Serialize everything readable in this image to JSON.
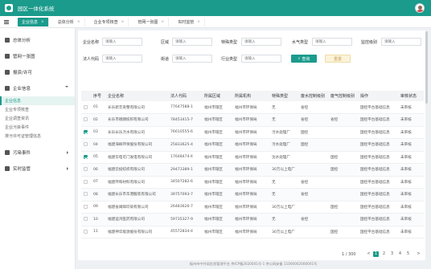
{
  "app": {
    "title": "园区一体化系统"
  },
  "tabs": [
    {
      "label": "企业信息",
      "close": "×"
    },
    {
      "label": "总体分析",
      "close": "×"
    },
    {
      "label": "企业专项核查",
      "close": "×"
    },
    {
      "label": "管网一张图",
      "close": "×"
    },
    {
      "label": "实时监管",
      "close": "×"
    }
  ],
  "sidebar": {
    "groups": [
      {
        "label": "总体分析"
      },
      {
        "label": "管网一张图"
      },
      {
        "label": "报资/许可"
      },
      {
        "label": "企业信息"
      },
      {
        "label": "污染事件"
      },
      {
        "label": "实时监管"
      }
    ],
    "sub_items": [
      {
        "label": "企业信息"
      },
      {
        "label": "企业专项核查"
      },
      {
        "label": "企业调查资讯"
      },
      {
        "label": "企业污染事件"
      },
      {
        "label": "排污许可证管理信息"
      }
    ]
  },
  "filters": {
    "company_name": {
      "label": "企业名称",
      "placeholder": "请输入"
    },
    "district": {
      "label": "区域",
      "placeholder": "请输入"
    },
    "special_type": {
      "label": "特殊类型",
      "placeholder": "请输入"
    },
    "water_type": {
      "label": "水气类型",
      "placeholder": "请输入"
    },
    "control_level": {
      "label": "监控级别",
      "placeholder": "请输入"
    },
    "legal_person": {
      "label": "法人代码",
      "placeholder": "请输入"
    },
    "street": {
      "label": "街道",
      "placeholder": "请输入"
    },
    "industry_type": {
      "label": "行业类型",
      "placeholder": "请输入"
    },
    "query_label": "查询",
    "reset_label": "重置"
  },
  "table": {
    "columns": [
      "序号",
      "企业名称",
      "法人代码",
      "所属区域",
      "所属机构",
      "特殊类型",
      "废水控制级别",
      "废气控制级别",
      "操作",
      "审核状态"
    ],
    "rows": [
      {
        "checked": false,
        "no": "01",
        "name": "长乐新丰染整有限公司",
        "code": "77647588-1",
        "area": "福州市辖区",
        "org": "福州市环保局",
        "special": "无",
        "water": "省控",
        "gas": "",
        "op": "国控平台基础信息",
        "status": "未审核"
      },
      {
        "checked": false,
        "no": "02",
        "name": "长乐市德朗纺织有限公司",
        "code": "78453415-7",
        "area": "福州市辖区",
        "org": "福州市环保局",
        "special": "无",
        "water": "省控",
        "gas": "省控",
        "op": "国控平台基础信息",
        "status": "未审核"
      },
      {
        "checked": true,
        "no": "03",
        "name": "长乐长乐污水有限公司",
        "code": "76610555-6",
        "area": "福州市辖区",
        "org": "福州市环保局",
        "special": "污水处理厂",
        "water": "国控",
        "gas": "",
        "op": "国控平台基础信息",
        "status": "未审核"
      },
      {
        "checked": false,
        "no": "04",
        "name": "福建海峡环保股份有限公司",
        "code": "25833625-4",
        "area": "福州市辖区",
        "org": "福州市环保局",
        "special": "污水处理厂",
        "water": "国控",
        "gas": "",
        "op": "国控平台基础信息",
        "status": "未审核"
      },
      {
        "checked": true,
        "no": "05",
        "name": "福建华电可门发电有限公司",
        "code": "17648474-X",
        "area": "福州市辖区",
        "org": "福州市环保局",
        "special": "沈水处理厂",
        "water": "",
        "gas": "国控",
        "op": "国控平台基础信息",
        "status": "未审核"
      },
      {
        "checked": false,
        "no": "06",
        "name": "福建云投纺织有限公司",
        "code": "29473389-1",
        "area": "福州市辖区",
        "org": "福州市环保局",
        "special": "30万以上电厂",
        "water": "",
        "gas": "国控",
        "op": "国控平台基础信息",
        "status": "未审核"
      },
      {
        "checked": false,
        "no": "07",
        "name": "福建环和材料有限公司",
        "code": "34507282-6",
        "area": "福州市辖区",
        "org": "福州市环保局",
        "special": "无",
        "water": "省控",
        "gas": "",
        "op": "国控平台基础信息",
        "status": "未审核"
      },
      {
        "checked": false,
        "no": "08",
        "name": "福建长乐市华港服装有限公司",
        "code": "39757093-7",
        "area": "福州市辖区",
        "org": "福州市环保局",
        "special": "无",
        "water": "省控",
        "gas": "",
        "op": "国控平台基础信息",
        "status": "未审核"
      },
      {
        "checked": false,
        "no": "09",
        "name": "福建省闽辉印染有限公司",
        "code": "26483626-7",
        "area": "福州市辖区",
        "org": "福州市环保局",
        "special": "30万以上电厂",
        "water": "",
        "gas": "国控",
        "op": "国控平台基础信息",
        "status": "未审核"
      },
      {
        "checked": false,
        "no": "10",
        "name": "福建运鸿医药有限公司",
        "code": "59735327-9",
        "area": "福州市辖区",
        "org": "福州市环保局",
        "special": "无",
        "water": "省控",
        "gas": "",
        "op": "国控平台基础信息",
        "status": "未审核"
      },
      {
        "checked": false,
        "no": "11",
        "name": "福建神华能源股份有限公司",
        "code": "45572834-4",
        "area": "福州市辖区",
        "org": "福州市环保局",
        "special": "30万以上电厂",
        "water": "",
        "gas": "国控",
        "op": "国控平台基础信息",
        "status": "未审核"
      }
    ]
  },
  "pager": {
    "current": "1",
    "total": "/ 300",
    "pages": [
      "1",
      "2",
      "3",
      "4",
      "5"
    ],
    "prev": "<",
    "next": ">"
  },
  "footer": {
    "text": "福州市中共局信息管理平台     京ICP备2020001号-1 京公网安备 11000002000001号"
  },
  "colors": {
    "accent": "#1b9b8c",
    "reset_bg": "#fbf3d9"
  }
}
